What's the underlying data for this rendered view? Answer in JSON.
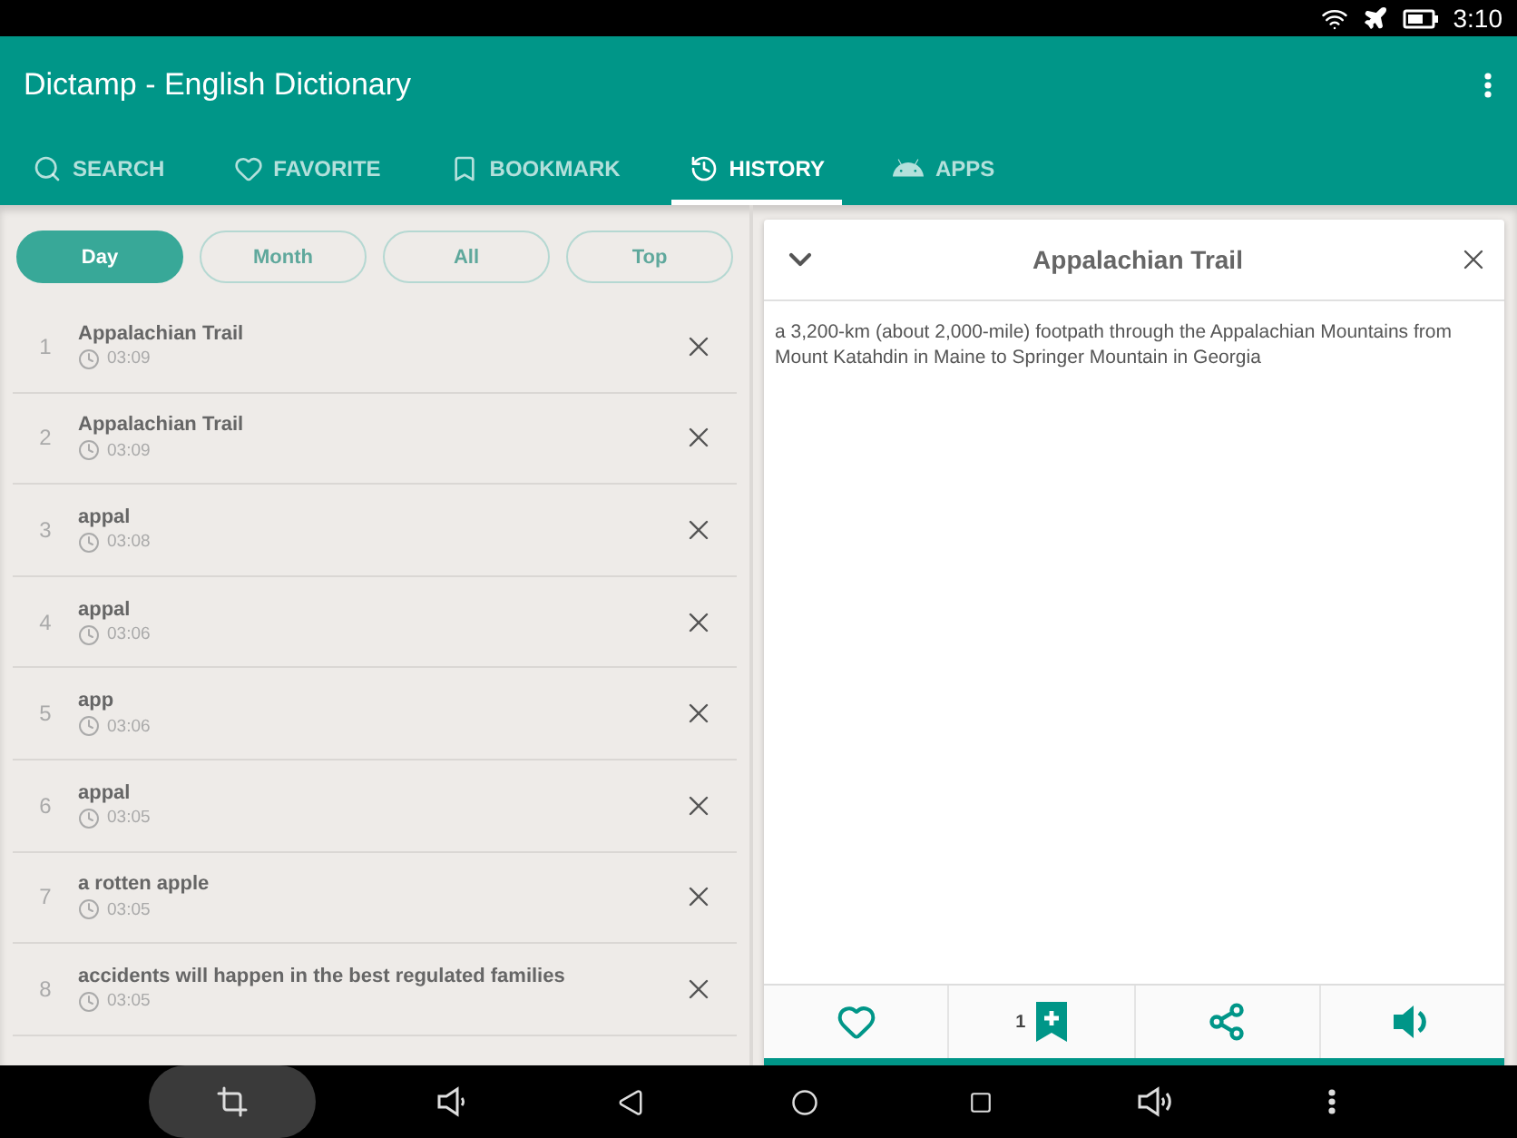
{
  "status_bar": {
    "time": "3:10"
  },
  "app_bar": {
    "title": "Dictamp - English Dictionary"
  },
  "tabs": [
    {
      "label": "SEARCH",
      "kind": "search",
      "selected": false
    },
    {
      "label": "FAVORITE",
      "kind": "favorite",
      "selected": false
    },
    {
      "label": "BOOKMARK",
      "kind": "bookmark",
      "selected": false
    },
    {
      "label": "HISTORY",
      "kind": "history",
      "selected": true
    },
    {
      "label": "APPS",
      "kind": "apps",
      "selected": false
    }
  ],
  "filters": [
    {
      "label": "Day",
      "selected": true
    },
    {
      "label": "Month",
      "selected": false
    },
    {
      "label": "All",
      "selected": false
    },
    {
      "label": "Top",
      "selected": false
    }
  ],
  "history": [
    {
      "index": "1",
      "word": "Appalachian Trail",
      "time": "03:09"
    },
    {
      "index": "2",
      "word": "Appalachian Trail",
      "time": "03:09"
    },
    {
      "index": "3",
      "word": "appal",
      "time": "03:08"
    },
    {
      "index": "4",
      "word": "appal",
      "time": "03:06"
    },
    {
      "index": "5",
      "word": "app",
      "time": "03:06"
    },
    {
      "index": "6",
      "word": "appal",
      "time": "03:05"
    },
    {
      "index": "7",
      "word": "a rotten apple",
      "time": "03:05"
    },
    {
      "index": "8",
      "word": "accidents will happen in the best regulated families",
      "time": "03:05"
    }
  ],
  "detail": {
    "title": "Appalachian Trail",
    "definition": "a 3,200-km (about 2,000-mile) footpath through the Appalachian Mountains from Mount Katahdin in Maine to Springer Mountain in Georgia",
    "bookmark_count": "1"
  }
}
